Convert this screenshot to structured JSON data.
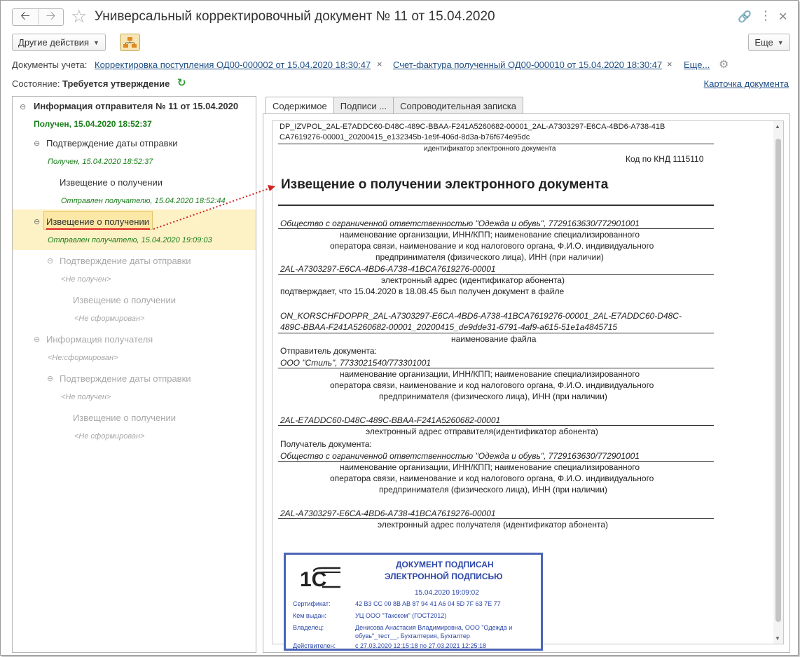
{
  "window": {
    "title": "Универсальный корректировочный документ № 11 от 15.04.2020"
  },
  "toolbar": {
    "other_actions": "Другие действия",
    "more": "Еще"
  },
  "documents": {
    "label": "Документы учета:",
    "link1": "Корректировка поступления ОД00-000002 от 15.04.2020 18:30:47",
    "link2": "Счет-фактура полученный ОД00-000010 от 15.04.2020 18:30:47",
    "more": "Еще..."
  },
  "state": {
    "label": "Состояние:",
    "value": "Требуется утверждение",
    "card_link": "Карточка документа"
  },
  "tree": {
    "n1": {
      "title": "Информация отправителя № 11 от 15.04.2020",
      "status": "Получен, 15.04.2020 18:52:37"
    },
    "n2": {
      "title": "Подтверждение даты отправки",
      "status": "Получен, 15.04.2020 18:52:37"
    },
    "n3": {
      "title": "Извещение о получении",
      "status": "Отправлен получателю, 15.04.2020 18:52:44"
    },
    "n4": {
      "title": "Извещение о получении",
      "status": "Отправлен получателю, 15.04.2020 19:09:03"
    },
    "n5": {
      "title": "Подтверждение даты отправки",
      "status": "<Не получен>"
    },
    "n6": {
      "title": "Извещение о получении",
      "status": "<Не сформирован>"
    },
    "n7": {
      "title": "Информация получателя",
      "status": "<Не:сформирован>"
    },
    "n8": {
      "title": "Подтверждение даты отправки",
      "status": "<Не получен>"
    },
    "n9": {
      "title": "Извещение о получении",
      "status": "<Не сформирован>"
    }
  },
  "tabs": [
    "Содержимое",
    "Подписи ...",
    "Сопроводительная записка"
  ],
  "doc": {
    "file_id_1": "DP_IZVPOL_2AL-E7ADDC60-D48C-489C-BBAA-F241A5260682-00001_2AL-A7303297-E6CA-4BD6-A738-41B",
    "file_id_2": "CA7619276-00001_20200415_e132345b-1e9f-406d-8d3a-b76f674e95dc",
    "file_id_caption": "идентификатор электронного документа",
    "knd": "Код по КНД 1115110",
    "heading": "Извещение о получении электронного документа",
    "org1": "Общество с ограниченной ответственностью \"Одежда и обувь\", 7729163630/772901001",
    "org_caption_1": "наименование организации, ИНН/КПП; наименование специализированного",
    "org_caption_2": "оператора связи, наименование и код налогового органа, Ф.И.О. индивидуального",
    "org_caption_3": "предпринимателя (физического лица), ИНН (при наличии)",
    "addr1": "2AL-A7303297-E6CA-4BD6-A738-41BCA7619276-00001",
    "addr1_caption": "электронный адрес (идентификатор абонента)",
    "confirm": "подтверждает, что 15.04.2020 в 18.08.45 был получен документ в файле",
    "file_1": "ON_KORSCHFDOPPR_2AL-A7303297-E6CA-4BD6-A738-41BCA7619276-00001_2AL-E7ADDC60-D48C-",
    "file_2": "489C-BBAA-F241A5260682-00001_20200415_de9dde31-6791-4af9-a615-51e1a4845715",
    "file_caption": "наименование файла",
    "sender_label": "Отправитель документа:",
    "sender": "ООО \"Стиль\", 7733021540/773301001",
    "sender_addr": "2AL-E7ADDC60-D48C-489C-BBAA-F241A5260682-00001",
    "sender_addr_caption": "электронный адрес отправителя(идентификатор абонента)",
    "receiver_label": "Получатель документа:",
    "receiver": "Общество с ограниченной ответственностью \"Одежда и обувь\", 7729163630/772901001",
    "receiver_addr": "2AL-A7303297-E6CA-4BD6-A738-41BCA7619276-00001",
    "receiver_addr_caption": "электронный адрес получателя (идентификатор абонента)"
  },
  "stamp": {
    "logo": "1С",
    "title_1": "ДОКУМЕНТ ПОДПИСАН",
    "title_2": "ЭЛЕКТРОННОЙ ПОДПИСЬЮ",
    "date": "15.04.2020 19:09:02",
    "cert_label": "Сертификат:",
    "cert_value": "42 B3 CC 00 8B AB 87 94 41 A6 04 5D 7F 63 7E 77",
    "issuer_label": "Кем выдан:",
    "issuer_value": "УЦ ООО \"Такском\" (ГОСТ2012)",
    "owner_label": "Владелец:",
    "owner_value_1": "Денисова Анастасия Владимировна, ООО \"Одежда и",
    "owner_value_2": "обувь\"_тест__, Бухгалтерия, Бухгалтер",
    "valid_label": "Действителен:",
    "valid_value": "с 27.03.2020 12:15:18 по 27.03.2021 12:25:18"
  },
  "colors": {
    "link": "#1f4f86",
    "status_green": "#1b7f1b",
    "selection": "#fdf2c5",
    "stamp_blue": "#2b46a8",
    "arrow_red": "#d22222"
  }
}
